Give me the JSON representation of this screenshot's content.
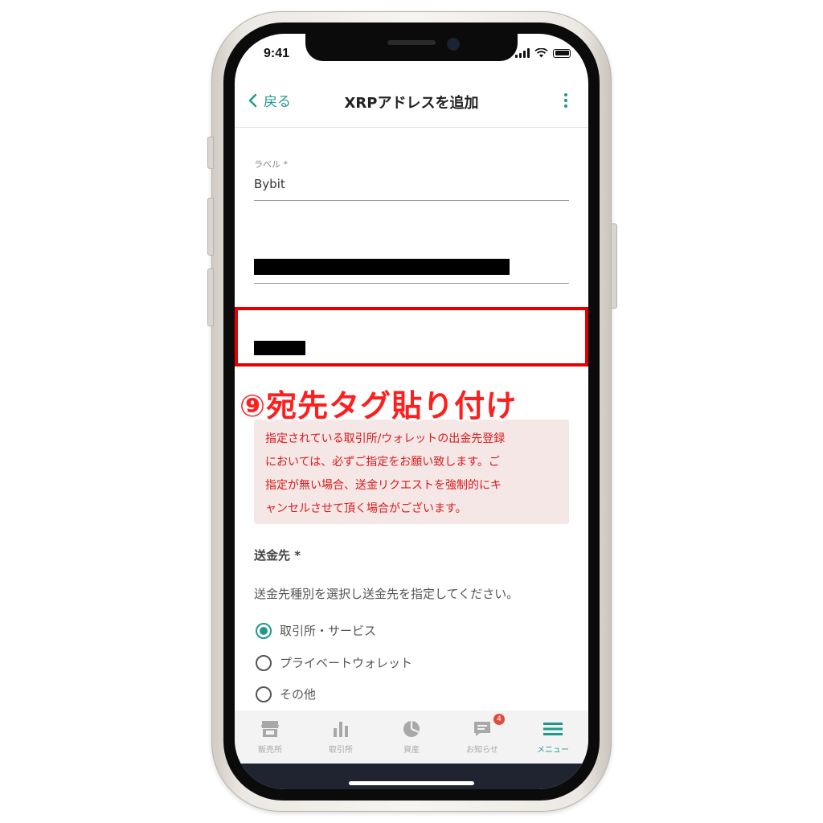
{
  "status_bar": {
    "time": "9:41"
  },
  "navbar": {
    "back_label": "戻る",
    "title": "XRPアドレスを追加"
  },
  "form": {
    "label_field": {
      "label": "ラベル *",
      "value": "Bybit"
    }
  },
  "callout": {
    "text": "⑨宛先タグ貼り付け"
  },
  "notice": {
    "lines": [
      "指定されている取引所/ウォレットの出金先登録",
      "においては、必ずご指定をお願い致します。ご",
      "指定が無い場合、送金リクエストを強制的にキ",
      "ャンセルさせて頂く場合がございます。"
    ]
  },
  "destination": {
    "title": "送金先 *",
    "description": "送金先種別を選択し送金先を指定してください。",
    "options": [
      "取引所・サービス",
      "プライベートウォレット",
      "その他"
    ],
    "selected": "取引所・サービス"
  },
  "tabbar": {
    "items": [
      {
        "label": "販売所",
        "icon": "shop-icon"
      },
      {
        "label": "取引所",
        "icon": "bar-chart-icon"
      },
      {
        "label": "資産",
        "icon": "pie-chart-icon"
      },
      {
        "label": "お知らせ",
        "icon": "message-icon",
        "badge": "4"
      },
      {
        "label": "メニュー",
        "icon": "menu-icon"
      }
    ],
    "active": "メニュー"
  },
  "colors": {
    "accent": "#1f9a8a",
    "alert": "#d81b1b",
    "highlight": "#e40000"
  }
}
